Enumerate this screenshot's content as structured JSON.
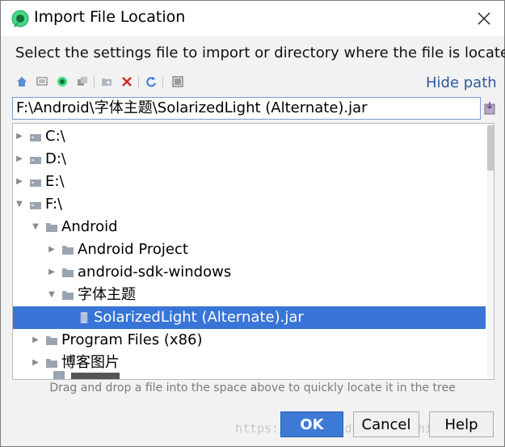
{
  "window": {
    "title": "Import File Location",
    "app_icon": "android-studio-icon",
    "close_icon": "close-icon"
  },
  "instruction": "Select the settings file to import or directory where the file is located",
  "toolbar": {
    "buttons": [
      {
        "icon": "home-icon"
      },
      {
        "icon": "desktop-icon"
      },
      {
        "icon": "project-icon"
      },
      {
        "icon": "module-icon"
      },
      {
        "icon": "new-folder-icon"
      },
      {
        "icon": "delete-icon"
      },
      {
        "icon": "refresh-icon"
      },
      {
        "icon": "show-hidden-icon"
      }
    ],
    "hide_path": "Hide path"
  },
  "path_field": {
    "value": "F:\\Android\\字体主题\\SolarizedLight (Alternate).jar"
  },
  "tree": {
    "rows": [
      {
        "label": "C:\\",
        "type": "drive",
        "expanded": false
      },
      {
        "label": "D:\\",
        "type": "drive",
        "expanded": false
      },
      {
        "label": "E:\\",
        "type": "drive",
        "expanded": false
      },
      {
        "label": "F:\\",
        "type": "drive",
        "expanded": true
      },
      {
        "label": "Android",
        "type": "folder",
        "expanded": true
      },
      {
        "label": "Android Project",
        "type": "folder",
        "expanded": false
      },
      {
        "label": "android-sdk-windows",
        "type": "folder",
        "expanded": false
      },
      {
        "label": "字体主题",
        "type": "folder",
        "expanded": true
      },
      {
        "label": "SolarizedLight (Alternate).jar",
        "type": "jar",
        "selected": true
      },
      {
        "label": "Program Files (x86)",
        "type": "folder",
        "expanded": false
      },
      {
        "label": "博客图片",
        "type": "folder",
        "expanded": false
      }
    ]
  },
  "hint": "Drag and drop a file into the space above to quickly locate it in the tree",
  "buttons": {
    "ok": "OK",
    "cancel": "Cancel",
    "help": "Help"
  },
  "watermark": "https://blog.csdn.net/luzhiba"
}
